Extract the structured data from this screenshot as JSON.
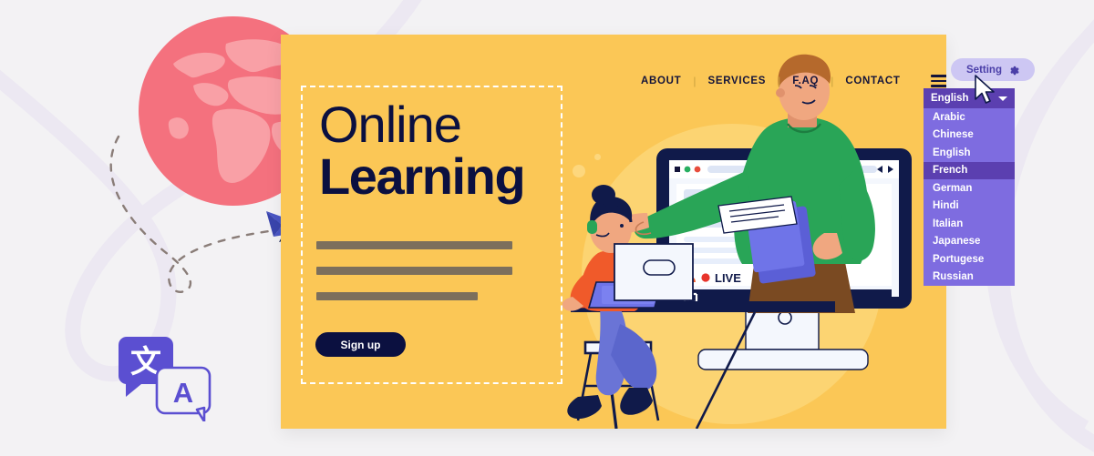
{
  "page": {
    "background_color": "#f3f2f4",
    "card_color": "#fbc756"
  },
  "nav": {
    "items": [
      {
        "label": "ABOUT",
        "name": "nav-about"
      },
      {
        "label": "SERVICES",
        "name": "nav-services"
      },
      {
        "label": "F.AQ",
        "name": "nav-faq"
      },
      {
        "label": "CONTACT",
        "name": "nav-contact"
      }
    ],
    "separator": "|",
    "menu_icon": "hamburger-menu-icon"
  },
  "hero": {
    "title_light": "Online",
    "title_bold": "Learning",
    "body_bars": [
      215,
      215,
      177
    ],
    "cta_label": "Sign up",
    "cta_bg": "#0b1040"
  },
  "setting": {
    "label": "Setting",
    "icon": "gear-icon",
    "bg_color": "#cdc7f3",
    "text_color": "#4b3fa8"
  },
  "language_dropdown": {
    "selected": "English",
    "header_bg": "#5b3fb0",
    "list_bg": "#7e6ce0",
    "highlight": "French",
    "caret_icon": "chevron-down-icon",
    "options": [
      "Arabic",
      "Chinese",
      "English",
      "French",
      "German",
      "Hindi",
      "Italian",
      "Japanese",
      "Portugese",
      "Russian"
    ]
  },
  "illustration": {
    "live_badge": "LIVE",
    "globe_color": "#f4717e",
    "globe_land_color": "#f9a0a6",
    "plane_color": "#4a56c4",
    "translate_icon": "translate-icon",
    "translate_glyph_primary": "文",
    "translate_glyph_secondary": "A",
    "browser_dots": [
      "#14143a",
      "#27ae60",
      "#e74c3c"
    ],
    "presenter_shirt_color": "#29a557",
    "student_shirt_color": "#f05a2a"
  },
  "cursor": {
    "name": "mouse-pointer-icon"
  }
}
